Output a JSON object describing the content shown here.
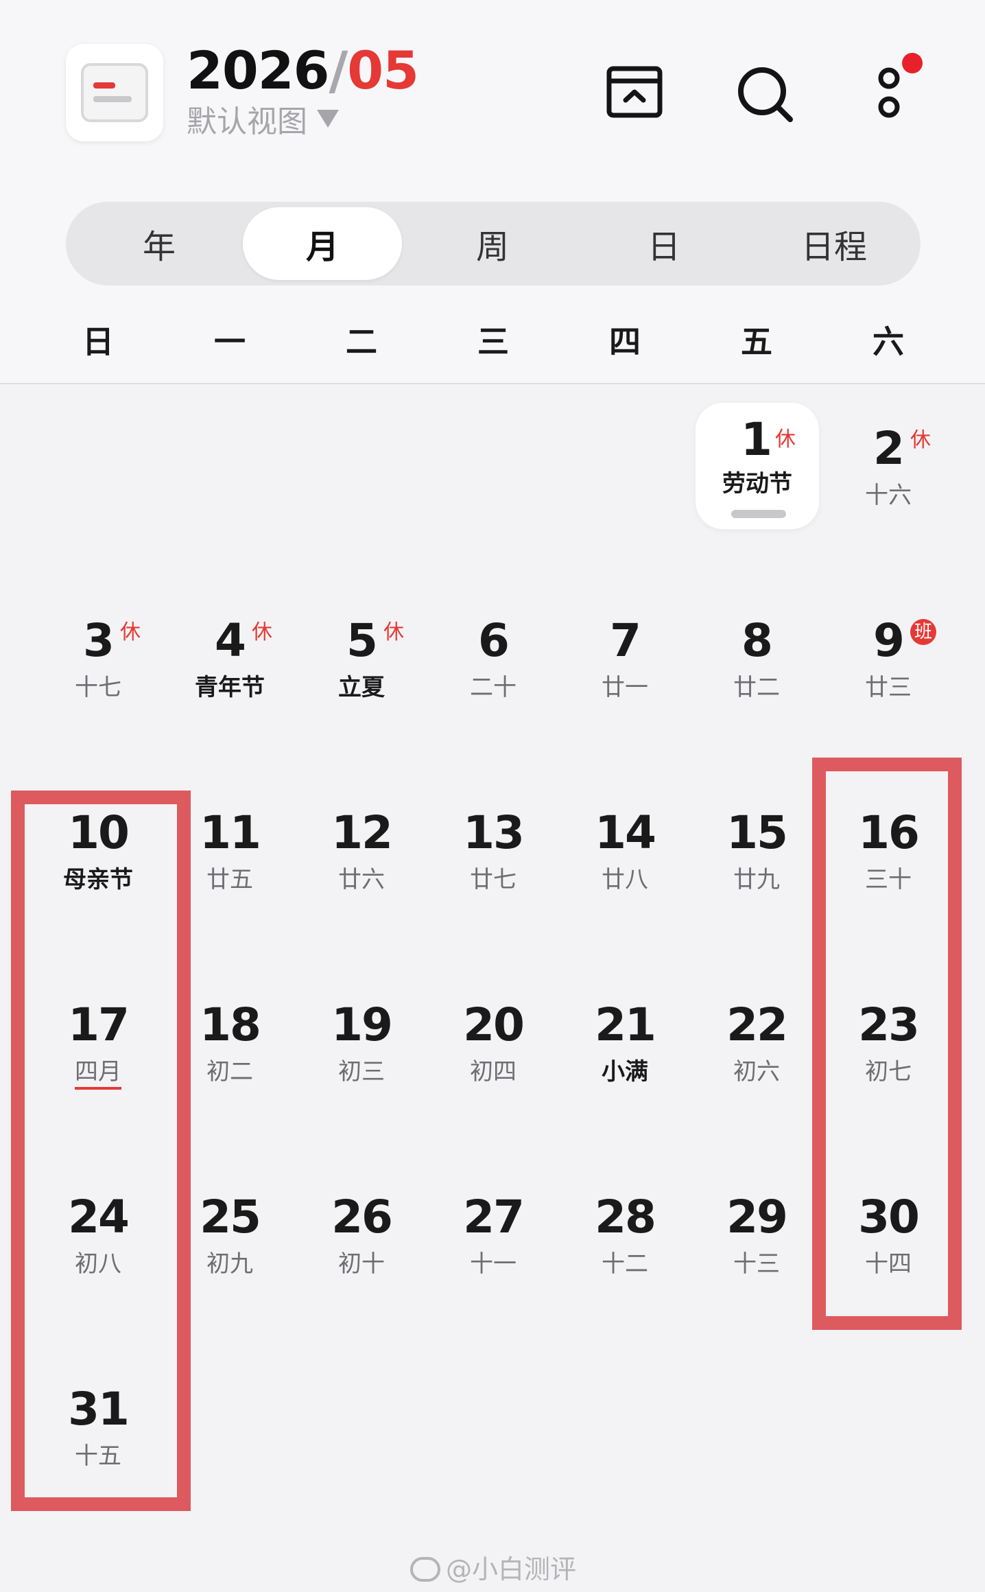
{
  "header": {
    "year": "2026",
    "separator": "/",
    "month": "05",
    "view_select": "默认视图",
    "icons": {
      "inbox": "inbox-icon",
      "search": "search-icon",
      "more": "more-icon"
    },
    "notification_dot": true
  },
  "tabs": [
    {
      "label": "年",
      "active": false
    },
    {
      "label": "月",
      "active": true
    },
    {
      "label": "周",
      "active": false
    },
    {
      "label": "日",
      "active": false
    },
    {
      "label": "日程",
      "active": false
    }
  ],
  "weekdays": [
    "日",
    "一",
    "二",
    "三",
    "四",
    "五",
    "六"
  ],
  "weeks": [
    [
      null,
      null,
      null,
      null,
      null,
      {
        "day": "1",
        "sub": "劳动节",
        "tag": "休",
        "sub_bold": true,
        "today": true
      },
      {
        "day": "2",
        "sub": "十六",
        "tag": "休"
      }
    ],
    [
      {
        "day": "3",
        "sub": "十七",
        "tag": "休"
      },
      {
        "day": "4",
        "sub": "青年节",
        "tag": "休",
        "sub_bold": true
      },
      {
        "day": "5",
        "sub": "立夏",
        "tag": "休",
        "sub_bold": true
      },
      {
        "day": "6",
        "sub": "二十"
      },
      {
        "day": "7",
        "sub": "廿一"
      },
      {
        "day": "8",
        "sub": "廿二"
      },
      {
        "day": "9",
        "sub": "廿三",
        "badge": "班"
      }
    ],
    [
      {
        "day": "10",
        "sub": "母亲节",
        "sub_bold": true
      },
      {
        "day": "11",
        "sub": "廿五"
      },
      {
        "day": "12",
        "sub": "廿六"
      },
      {
        "day": "13",
        "sub": "廿七"
      },
      {
        "day": "14",
        "sub": "廿八"
      },
      {
        "day": "15",
        "sub": "廿九"
      },
      {
        "day": "16",
        "sub": "三十"
      }
    ],
    [
      {
        "day": "17",
        "sub": "四月",
        "underline": true
      },
      {
        "day": "18",
        "sub": "初二"
      },
      {
        "day": "19",
        "sub": "初三"
      },
      {
        "day": "20",
        "sub": "初四"
      },
      {
        "day": "21",
        "sub": "小满",
        "sub_bold": true
      },
      {
        "day": "22",
        "sub": "初六"
      },
      {
        "day": "23",
        "sub": "初七"
      }
    ],
    [
      {
        "day": "24",
        "sub": "初八"
      },
      {
        "day": "25",
        "sub": "初九"
      },
      {
        "day": "26",
        "sub": "初十"
      },
      {
        "day": "27",
        "sub": "十一"
      },
      {
        "day": "28",
        "sub": "十二"
      },
      {
        "day": "29",
        "sub": "十三"
      },
      {
        "day": "30",
        "sub": "十四"
      }
    ],
    [
      {
        "day": "31",
        "sub": "十五"
      },
      null,
      null,
      null,
      null,
      null,
      null
    ]
  ],
  "watermark": "@小白测评",
  "colors": {
    "accent": "#e53935",
    "highlight_border": "#dd5a5f",
    "background": "#f3f3f5"
  }
}
